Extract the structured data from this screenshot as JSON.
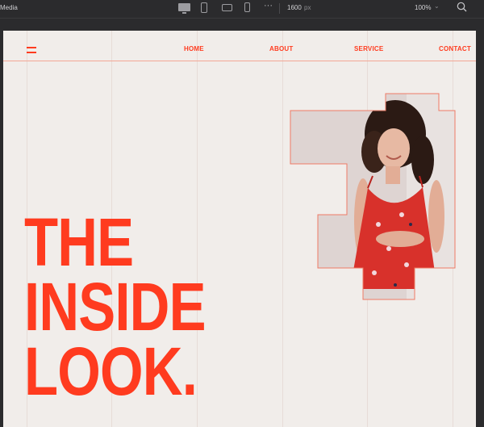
{
  "editor": {
    "title": "Media",
    "width_value": "1600",
    "width_unit": "px",
    "zoom": "100%",
    "devices": [
      "desktop-icon",
      "tablet-icon",
      "landscape-icon",
      "phone-icon"
    ]
  },
  "site": {
    "nav": [
      "HOME",
      "ABOUT",
      "SERVICE",
      "CONTACT"
    ],
    "headline": [
      "THE",
      "INSIDE",
      "LOOK."
    ],
    "accent_color": "#ff3b1f",
    "page_color": "#f1edea"
  }
}
